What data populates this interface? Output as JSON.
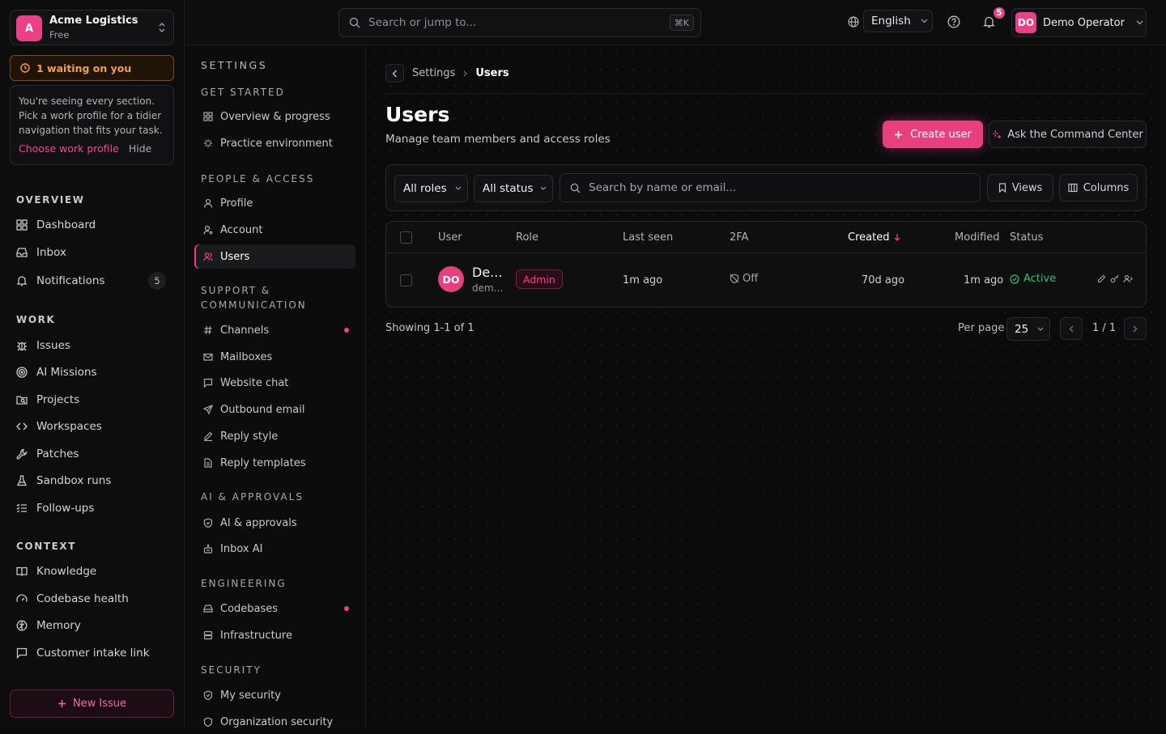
{
  "org": {
    "initial": "A",
    "name": "Acme Logistics",
    "plan": "Free"
  },
  "waiting": {
    "label": "1 waiting on you"
  },
  "hint": {
    "text": "You're seeing every section. Pick a work profile for a tidier navigation that fits your task.",
    "choose": "Choose work profile",
    "hide": "Hide"
  },
  "sidebar": {
    "overview_heading": "OVERVIEW",
    "overview": [
      {
        "label": "Dashboard",
        "icon": "dashboard-icon"
      },
      {
        "label": "Inbox",
        "icon": "inbox-icon"
      },
      {
        "label": "Notifications",
        "icon": "bell-icon",
        "badge": "5"
      }
    ],
    "work_heading": "WORK",
    "work": [
      {
        "label": "Issues",
        "icon": "bug-icon"
      },
      {
        "label": "AI Missions",
        "icon": "target-icon"
      },
      {
        "label": "Projects",
        "icon": "folder-icon"
      },
      {
        "label": "Workspaces",
        "icon": "code-icon"
      },
      {
        "label": "Patches",
        "icon": "wrench-icon"
      },
      {
        "label": "Sandbox runs",
        "icon": "flask-icon"
      },
      {
        "label": "Follow-ups",
        "icon": "list-check-icon"
      }
    ],
    "context_heading": "CONTEXT",
    "context": [
      {
        "label": "Knowledge",
        "icon": "book-icon"
      },
      {
        "label": "Codebase health",
        "icon": "gauge-icon"
      },
      {
        "label": "Memory",
        "icon": "brain-icon"
      },
      {
        "label": "Customer intake link",
        "icon": "message-square-icon"
      }
    ],
    "new_issue": "New Issue"
  },
  "topbar": {
    "search_placeholder": "Search or jump to...",
    "shortcut": "⌘K",
    "language": "English",
    "notif_count": "5",
    "user_initials": "DO",
    "user_name": "Demo Operator"
  },
  "settings_nav": {
    "title": "SETTINGS",
    "sections": [
      {
        "heading": "GET STARTED",
        "items": [
          {
            "label": "Overview & progress",
            "icon": "grid-icon"
          },
          {
            "label": "Practice environment",
            "icon": "sparkle-icon"
          }
        ]
      },
      {
        "heading": "PEOPLE & ACCESS",
        "items": [
          {
            "label": "Profile",
            "icon": "user-icon"
          },
          {
            "label": "Account",
            "icon": "user-gear-icon"
          },
          {
            "label": "Users",
            "icon": "users-icon",
            "active": true
          }
        ]
      },
      {
        "heading": "SUPPORT & COMMUNICATION",
        "items": [
          {
            "label": "Channels",
            "icon": "hash-icon",
            "dot": true
          },
          {
            "label": "Mailboxes",
            "icon": "mail-icon"
          },
          {
            "label": "Website chat",
            "icon": "chat-icon"
          },
          {
            "label": "Outbound email",
            "icon": "send-icon"
          },
          {
            "label": "Reply style",
            "icon": "pen-icon"
          },
          {
            "label": "Reply templates",
            "icon": "file-icon"
          }
        ]
      },
      {
        "heading": "AI & APPROVALS",
        "items": [
          {
            "label": "AI & approvals",
            "icon": "shield-check-icon"
          },
          {
            "label": "Inbox AI",
            "icon": "inbox-robot-icon"
          }
        ]
      },
      {
        "heading": "ENGINEERING",
        "items": [
          {
            "label": "Codebases",
            "icon": "drive-icon",
            "dot": true
          },
          {
            "label": "Infrastructure",
            "icon": "server-icon"
          }
        ]
      },
      {
        "heading": "SECURITY",
        "items": [
          {
            "label": "My security",
            "icon": "shield-icon"
          },
          {
            "label": "Organization security",
            "icon": "shield-icon"
          }
        ]
      }
    ]
  },
  "main": {
    "breadcrumb": {
      "parent": "Settings",
      "current": "Users"
    },
    "title": "Users",
    "subtitle": "Manage team members and access roles",
    "create_user": "Create user",
    "ask": "Ask the Command Center",
    "filters": {
      "roles": "All roles",
      "status": "All status",
      "search_placeholder": "Search by name or email...",
      "views": "Views",
      "columns": "Columns"
    },
    "table": {
      "columns": {
        "user": "User",
        "role": "Role",
        "last_seen": "Last seen",
        "twofa": "2FA",
        "created": "Created",
        "modified": "Modified",
        "status": "Status"
      },
      "rows": [
        {
          "initials": "DO",
          "name": "De...",
          "email": "dem...",
          "role": "Admin",
          "last_seen": "1m ago",
          "twofa": "Off",
          "created": "70d ago",
          "modified": "1m ago",
          "status": "Active"
        }
      ]
    },
    "pagination": {
      "showing": "Showing 1-1 of 1",
      "per_page_label": "Per page",
      "per_page": "25",
      "page": "1 / 1"
    }
  },
  "colors": {
    "accent": "#ec3f86",
    "active_green": "#27c07a",
    "warning": "#f0a24a"
  }
}
